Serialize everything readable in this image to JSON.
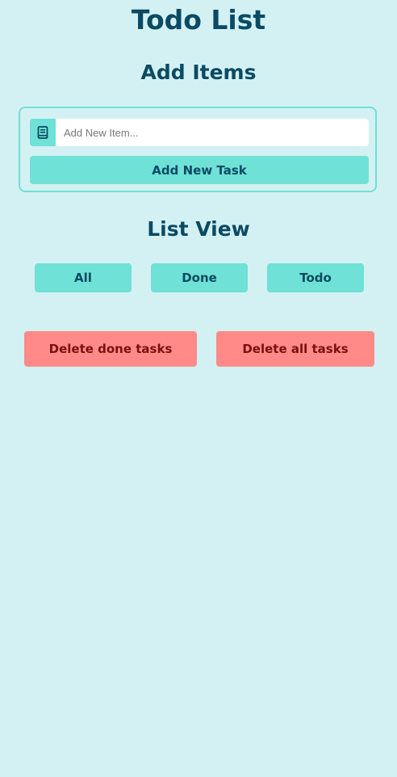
{
  "header": {
    "title": "Todo List"
  },
  "add_section": {
    "title": "Add Items",
    "input_placeholder": "Add New Item...",
    "input_icon": "book-icon",
    "add_button_label": "Add New Task"
  },
  "list_section": {
    "title": "List View",
    "filters": [
      {
        "label": "All"
      },
      {
        "label": "Done"
      },
      {
        "label": "Todo"
      }
    ]
  },
  "actions": {
    "delete_done_label": "Delete done tasks",
    "delete_all_label": "Delete all tasks"
  },
  "colors": {
    "background": "#d3f1f3",
    "accent": "#6fe1d6",
    "text": "#0b4a63",
    "danger": "#ff8a87",
    "danger_text": "#7a1010"
  }
}
